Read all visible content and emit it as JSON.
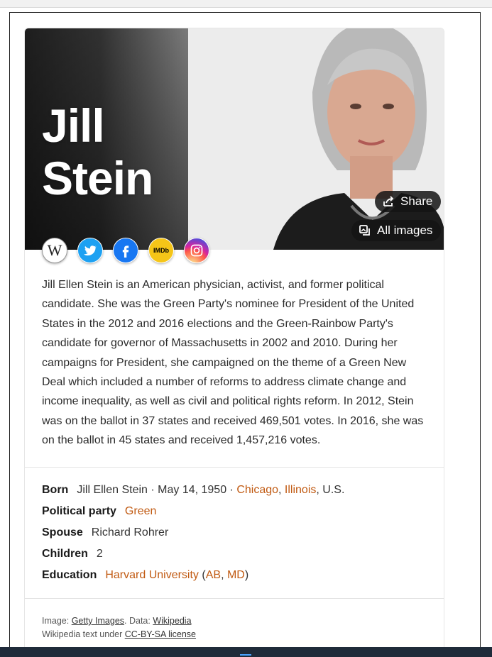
{
  "hero": {
    "title_line1": "Jill",
    "title_line2": "Stein",
    "share_label": "Share",
    "all_images_label": "All images"
  },
  "socials": [
    {
      "name": "wikipedia-icon",
      "glyph": "W"
    },
    {
      "name": "twitter-icon"
    },
    {
      "name": "facebook-icon"
    },
    {
      "name": "imdb-icon",
      "glyph": "IMDb"
    },
    {
      "name": "instagram-icon"
    }
  ],
  "description": "Jill Ellen Stein is an American physician, activist, and former political candidate. She was the Green Party's nominee for President of the United States in the 2012 and 2016 elections and the Green-Rainbow Party's candidate for governor of Massachusetts in 2002 and 2010. During her campaigns for President, she campaigned on the theme of a Green New Deal which included a number of reforms to address climate change and income inequality, as well as civil and political rights reform. In 2012, Stein was on the ballot in 37 states and received 469,501 votes. In 2016, she was on the ballot in 45 states and received 1,457,216 votes.",
  "facts": {
    "born": {
      "label": "Born",
      "value": "Jill Ellen Stein · May 14, 1950 · ",
      "city": "Chicago",
      "sep": ", ",
      "state": "Illinois",
      "country": ", U.S."
    },
    "party": {
      "label": "Political party",
      "value": "Green"
    },
    "spouse": {
      "label": "Spouse",
      "value": "Richard Rohrer"
    },
    "children": {
      "label": "Children",
      "value": "2"
    },
    "education": {
      "label": "Education",
      "school": "Harvard University",
      "open": " (",
      "deg1": "AB",
      "comma": ", ",
      "deg2": "MD",
      "close": ")"
    }
  },
  "attribution": {
    "image_prefix": "Image: ",
    "image_source": "Getty Images",
    "data_prefix": ". Data: ",
    "data_source": "Wikipedia",
    "license_prefix": "Wikipedia text under ",
    "license": "CC-BY-SA license"
  },
  "colors": {
    "link": "#c15a12",
    "twitter": "#1da1f2",
    "facebook": "#1877f2",
    "imdb": "#f5c518"
  }
}
